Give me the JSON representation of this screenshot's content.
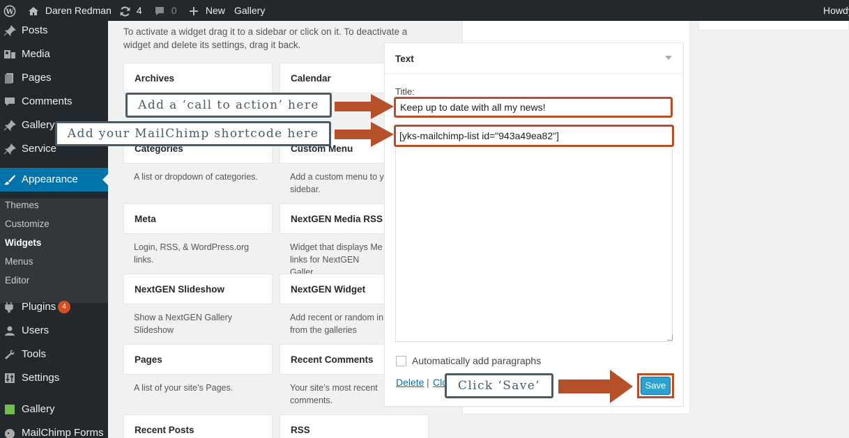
{
  "adminbar": {
    "site_name": "Daren Redman",
    "updates_count": "4",
    "comments_count": "0",
    "new_label": "New",
    "gallery_label": "Gallery",
    "howdy": "Howdy"
  },
  "sidebar": {
    "items": [
      {
        "label": "Posts"
      },
      {
        "label": "Media"
      },
      {
        "label": "Pages"
      },
      {
        "label": "Comments"
      },
      {
        "label": "Gallery"
      },
      {
        "label": "Service"
      },
      {
        "label": "Appearance"
      },
      {
        "label": "Plugins"
      },
      {
        "label": "Users"
      },
      {
        "label": "Tools"
      },
      {
        "label": "Settings"
      },
      {
        "label": "Gallery"
      },
      {
        "label": "MailChimp Forms"
      }
    ],
    "plugins_badge": "4",
    "submenu": [
      {
        "label": "Themes"
      },
      {
        "label": "Customize"
      },
      {
        "label": "Widgets"
      },
      {
        "label": "Menus"
      },
      {
        "label": "Editor"
      }
    ]
  },
  "main": {
    "intro": "To activate a widget drag it to a sidebar or click on it. To deactivate a widget and delete its settings, drag it back.",
    "widgets": [
      {
        "title": "Archives",
        "desc": ""
      },
      {
        "title": "Calendar",
        "desc": ""
      },
      {
        "title": "Categories",
        "desc": "A list or dropdown of categories."
      },
      {
        "title": "Custom Menu",
        "desc": "Add a custom menu to y sidebar."
      },
      {
        "title": "Meta",
        "desc": "Login, RSS, & WordPress.org links."
      },
      {
        "title": "NextGEN Media RSS",
        "desc": "Widget that displays Me links for NextGEN Galler"
      },
      {
        "title": "NextGEN Slideshow",
        "desc": "Show a NextGEN Gallery Slideshow"
      },
      {
        "title": "NextGEN Widget",
        "desc": "Add recent or random in from the galleries"
      },
      {
        "title": "Pages",
        "desc": "A list of your site’s Pages."
      },
      {
        "title": "Recent Comments",
        "desc": "Your site’s most recent comments."
      },
      {
        "title": "Recent Posts",
        "desc": ""
      },
      {
        "title": "RSS",
        "desc": ""
      }
    ]
  },
  "text_widget": {
    "header": "Text",
    "title_label": "Title:",
    "title_value": "Keep up to date with all my news!",
    "content_value": "[yks-mailchimp-list id=\"943a49ea82\"]",
    "auto_paragraphs_label": "Automatically add paragraphs",
    "delete_label": "Delete",
    "separator": "|",
    "close_label": "Clo",
    "save_label": "Save"
  },
  "callouts": {
    "call_to_action": "Add a ‘call to action’ here",
    "shortcode": "Add your MailChimp shortcode here",
    "save": "Click ‘Save’"
  },
  "colors": {
    "admin_dark": "#23282d",
    "accent_blue": "#0073aa",
    "callout_border": "#4a5b63",
    "arrow_orange": "#b5502a"
  }
}
